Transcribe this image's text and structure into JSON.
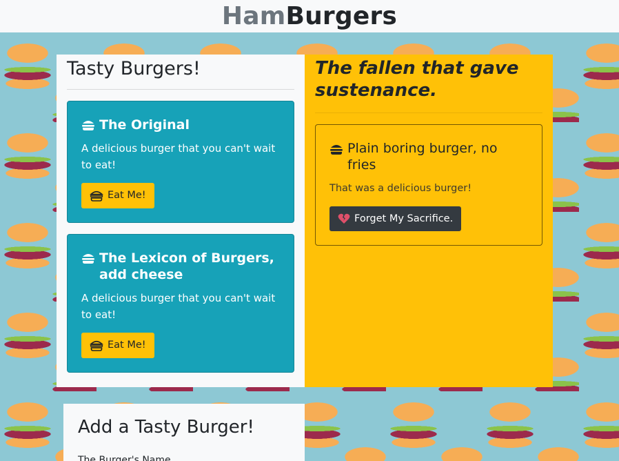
{
  "header": {
    "brand_part1": "Ham",
    "brand_part2": "Burgers"
  },
  "left_column": {
    "title": "Tasty Burgers!",
    "cards": [
      {
        "title": "The Original",
        "text": "A delicious burger that you can't wait to eat!",
        "button_label": "Eat Me!",
        "title_icon": "burger-icon",
        "button_icon": "burger-icon"
      },
      {
        "title": "The Lexicon of Burgers, add cheese",
        "text": "A delicious burger that you can't wait to eat!",
        "button_label": "Eat Me!",
        "title_icon": "burger-icon",
        "button_icon": "burger-icon"
      }
    ]
  },
  "right_column": {
    "title": "The fallen that gave sustenance.",
    "cards": [
      {
        "title": "Plain boring burger, no fries",
        "text": "That was a delicious burger!",
        "button_label": "Forget My Sacrifice.",
        "title_icon": "hamburger-icon",
        "button_icon": "heart-broken-icon"
      }
    ]
  },
  "form": {
    "title": "Add a Tasty Burger!",
    "label": "The Burger's Name"
  },
  "colors": {
    "info": "#17a2b8",
    "warning": "#ffc107",
    "dark": "#343a40",
    "light": "#f8f9fa",
    "background": "#8dc8d4",
    "heart": "#dc3545"
  }
}
